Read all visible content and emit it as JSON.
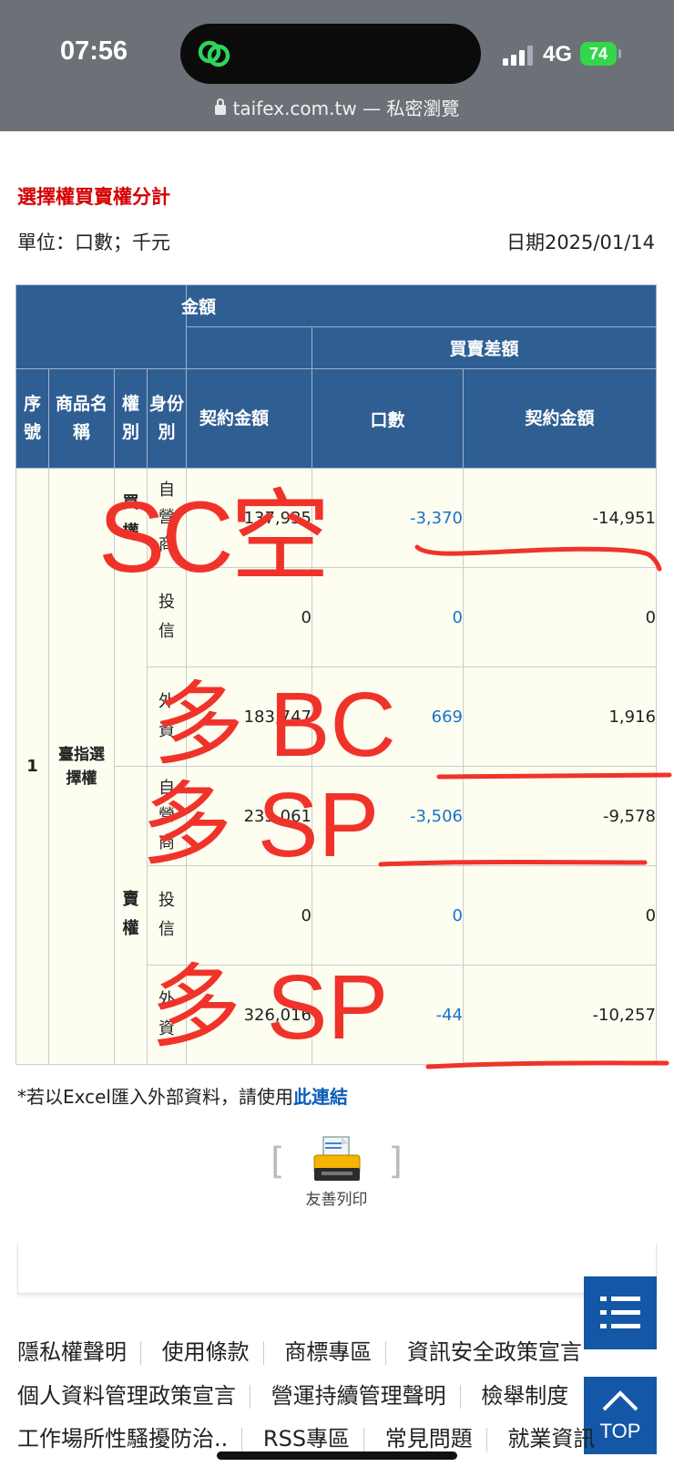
{
  "status_bar": {
    "time": "07:56",
    "network": "4G",
    "battery": "74"
  },
  "browser": {
    "url": "taifex.com.tw — 私密瀏覽"
  },
  "page": {
    "title": "選擇權買賣權分計",
    "unit": "單位：口數；千元",
    "date": "日期2025/01/14"
  },
  "table": {
    "header_top": "金額",
    "header_diff": "買賣差額",
    "col_seq": "序號",
    "col_product": "商品名稱",
    "col_right": "權別",
    "col_identity": "身份別",
    "col_amount": "契約金額",
    "col_lots": "口數",
    "col_diff_amount": "契約金額",
    "seq": "1",
    "product": "臺指選擇權",
    "right_call": "買權",
    "right_put": "賣權",
    "rows": [
      {
        "identity": "自營商",
        "amount": "137,935",
        "lots": "-3,370",
        "diff_amount": "-14,951"
      },
      {
        "identity": "投信",
        "amount": "0",
        "lots": "0",
        "diff_amount": "0"
      },
      {
        "identity": "外資",
        "amount": "183,747",
        "lots": "669",
        "diff_amount": "1,916"
      },
      {
        "identity": "自營商",
        "amount": "235,061",
        "lots": "-3,506",
        "diff_amount": "-9,578"
      },
      {
        "identity": "投信",
        "amount": "0",
        "lots": "0",
        "diff_amount": "0"
      },
      {
        "identity": "外資",
        "amount": "326,016",
        "lots": "-44",
        "diff_amount": "-10,257"
      }
    ]
  },
  "note": {
    "text": "*若以Excel匯入外部資料，請使用",
    "link": "此連結"
  },
  "print": {
    "label": "友善列印"
  },
  "footer": {
    "line1": [
      "隱私權聲明",
      "使用條款",
      "商標專區",
      "資訊安全政策宣言"
    ],
    "line2": [
      "個人資料管理政策宣言",
      "營運持續管理聲明",
      "檢舉制度"
    ],
    "line3": [
      "工作場所性騷擾防治..",
      "RSS專區",
      "常見問題",
      "就業資訊"
    ]
  },
  "buttons": {
    "top": "TOP"
  },
  "annotations": {
    "a1": "SC空",
    "a2": "多 BC",
    "a3": "多 SP",
    "a4": "多 SP",
    "color": "#f0332a"
  }
}
